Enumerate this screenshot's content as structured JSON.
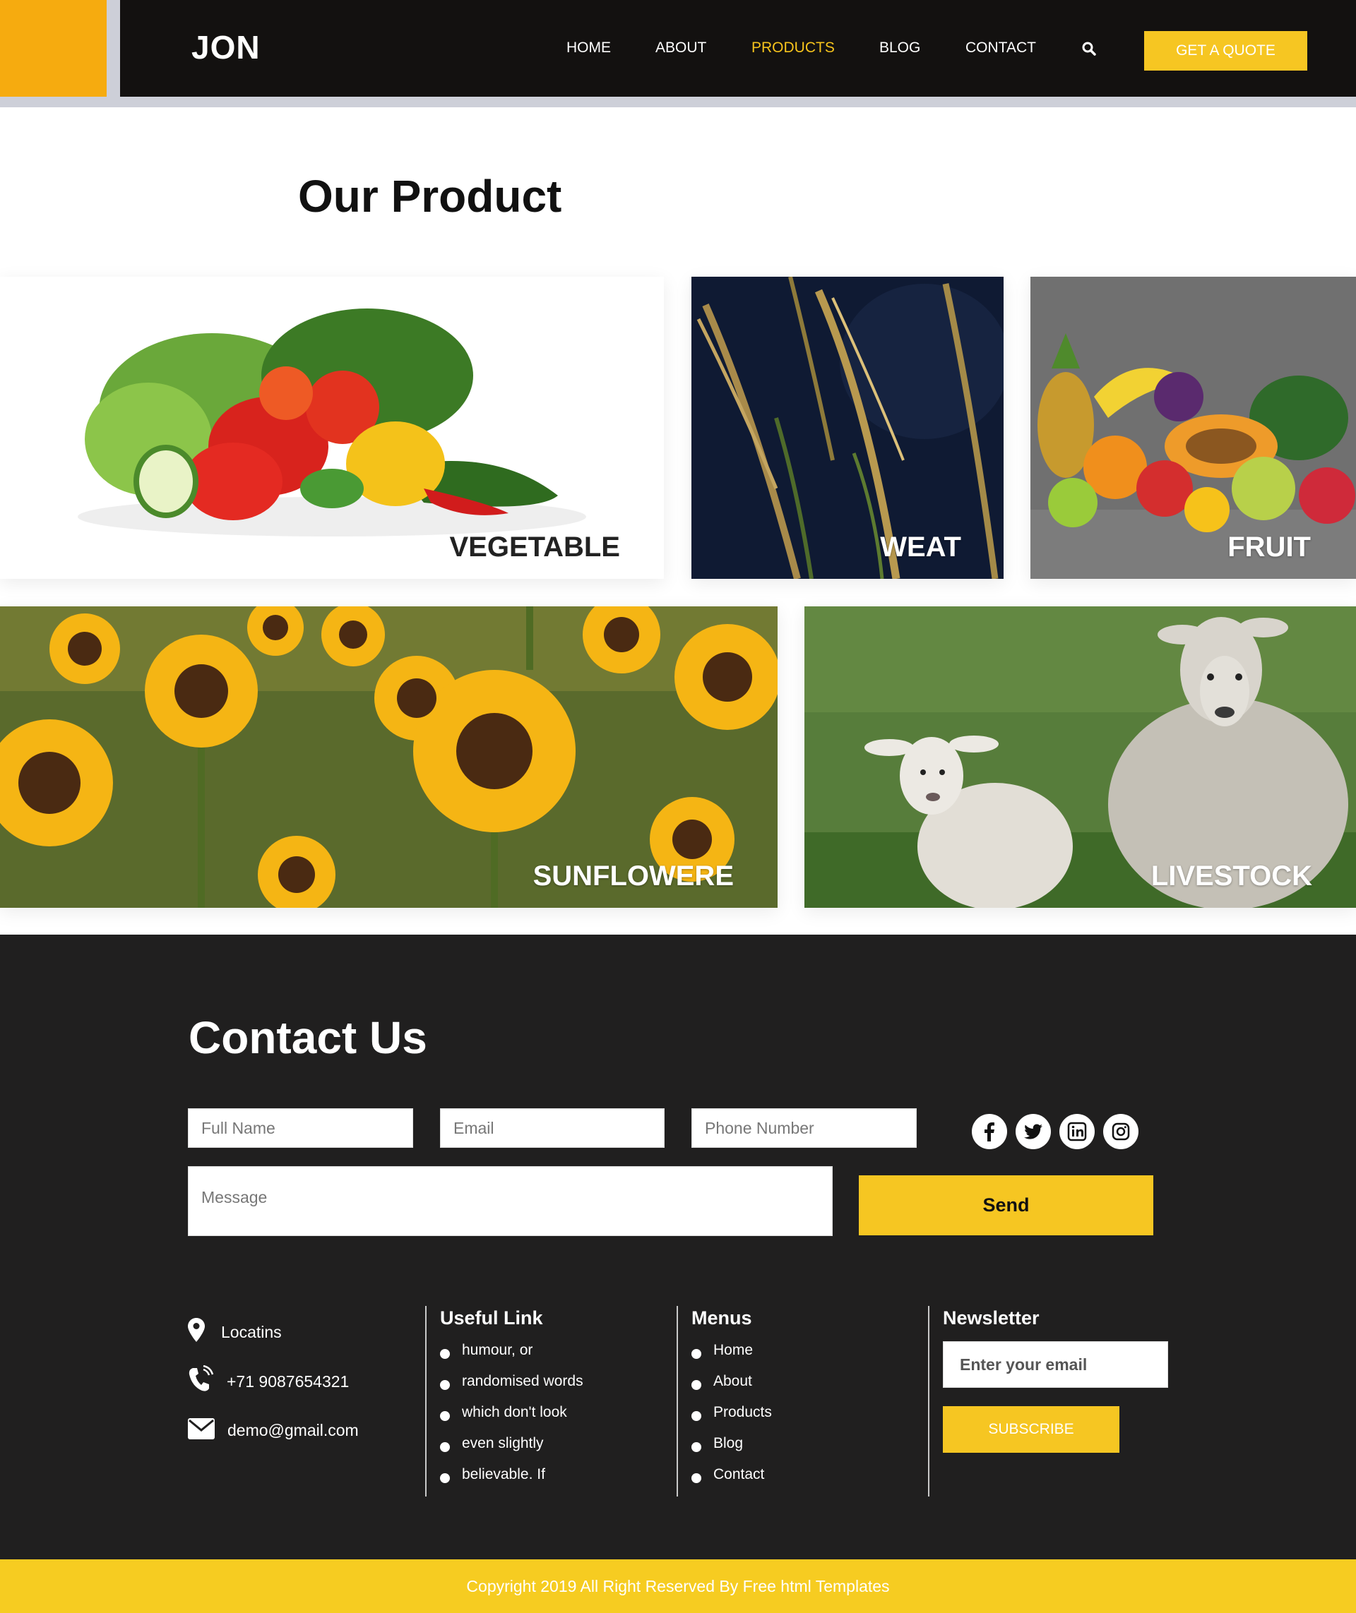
{
  "header": {
    "logo": "JON",
    "nav": [
      {
        "label": "HOME",
        "active": false
      },
      {
        "label": "ABOUT",
        "active": false
      },
      {
        "label": "PRODUCTS",
        "active": true
      },
      {
        "label": "BLOG",
        "active": false
      },
      {
        "label": "CONTACT",
        "active": false
      }
    ],
    "search_icon": "search-icon",
    "quote_button": "GET A QUOTE"
  },
  "products": {
    "title": "Our Product",
    "tiles": [
      {
        "label": "VEGETABLE"
      },
      {
        "label": "WEAT"
      },
      {
        "label": "FRUIT"
      },
      {
        "label": "SUNFLOWERE"
      },
      {
        "label": "LIVESTOCK"
      }
    ]
  },
  "contact": {
    "title": "Contact Us",
    "form": {
      "full_name_placeholder": "Full Name",
      "email_placeholder": "Email",
      "phone_placeholder": "Phone Number",
      "message_placeholder": "Message",
      "send_label": "Send"
    },
    "social": [
      "facebook-icon",
      "twitter-icon",
      "linkedin-icon",
      "instagram-icon"
    ],
    "info": {
      "location": "Locatins",
      "phone": "+71 9087654321",
      "email": "demo@gmail.com"
    },
    "useful_links": {
      "title": "Useful Link",
      "items": [
        "humour, or",
        "randomised words",
        "which don't look",
        "even slightly",
        "believable. If"
      ]
    },
    "menus": {
      "title": "Menus",
      "items": [
        "Home",
        "About",
        "Products",
        "Blog",
        "Contact"
      ]
    },
    "newsletter": {
      "title": "Newsletter",
      "placeholder": "Enter your email",
      "button": "SUBSCRIBE"
    }
  },
  "footer": {
    "copyright": "Copyright 2019 All Right Reserved By Free html Templates"
  },
  "colors": {
    "accent_yellow": "#f6c622",
    "header_orange": "#f6ab0f",
    "header_dark": "#131110",
    "contact_bg": "#201f1f",
    "footer_yellow": "#f6cc21"
  }
}
